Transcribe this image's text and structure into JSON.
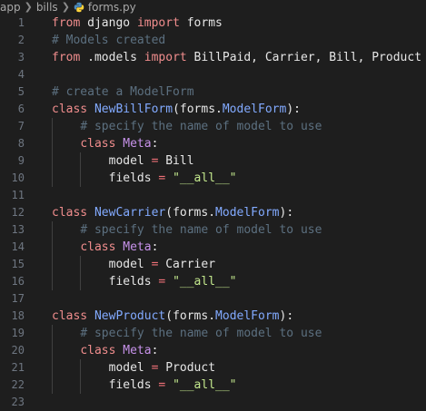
{
  "breadcrumb": {
    "items": [
      "app",
      "bills",
      "forms.py"
    ]
  },
  "icons": {
    "separator": "chevron-right-icon",
    "file": "python-file-icon"
  },
  "colors": {
    "background": "#1e1e1e",
    "keyword": "#f07178",
    "class_name": "#82aaff",
    "string": "#c3e88d",
    "comment": "#5c7080"
  },
  "editor": {
    "lines": [
      [
        [
          "kw",
          "from"
        ],
        [
          "plain",
          " django "
        ],
        [
          "kw",
          "import"
        ],
        [
          "plain",
          " forms"
        ]
      ],
      [
        [
          "cmt",
          "# Models created"
        ]
      ],
      [
        [
          "kw",
          "from"
        ],
        [
          "plain",
          " .models "
        ],
        [
          "kw",
          "import"
        ],
        [
          "plain",
          " BillPaid, Carrier, Bill, Product"
        ]
      ],
      [],
      [
        [
          "cmt",
          "# create a ModelForm"
        ]
      ],
      [
        [
          "kw",
          "class"
        ],
        [
          "plain",
          " "
        ],
        [
          "fn",
          "NewBillForm"
        ],
        [
          "plain",
          "(forms."
        ],
        [
          "fn",
          "ModelForm"
        ],
        [
          "plain",
          "):"
        ]
      ],
      [
        [
          "plain",
          "    "
        ],
        [
          "cmt",
          "# specify the name of model to use"
        ]
      ],
      [
        [
          "plain",
          "    "
        ],
        [
          "kw",
          "class"
        ],
        [
          "plain",
          " "
        ],
        [
          "cls",
          "Meta"
        ],
        [
          "plain",
          ":"
        ]
      ],
      [
        [
          "plain",
          "        model "
        ],
        [
          "op",
          "="
        ],
        [
          "plain",
          " Bill"
        ]
      ],
      [
        [
          "plain",
          "        fields "
        ],
        [
          "op",
          "="
        ],
        [
          "plain",
          " "
        ],
        [
          "str",
          "\"__all__\""
        ]
      ],
      [],
      [
        [
          "kw",
          "class"
        ],
        [
          "plain",
          " "
        ],
        [
          "fn",
          "NewCarrier"
        ],
        [
          "plain",
          "(forms."
        ],
        [
          "fn",
          "ModelForm"
        ],
        [
          "plain",
          "):"
        ]
      ],
      [
        [
          "plain",
          "    "
        ],
        [
          "cmt",
          "# specify the name of model to use"
        ]
      ],
      [
        [
          "plain",
          "    "
        ],
        [
          "kw",
          "class"
        ],
        [
          "plain",
          " "
        ],
        [
          "cls",
          "Meta"
        ],
        [
          "plain",
          ":"
        ]
      ],
      [
        [
          "plain",
          "        model "
        ],
        [
          "op",
          "="
        ],
        [
          "plain",
          " Carrier"
        ]
      ],
      [
        [
          "plain",
          "        fields "
        ],
        [
          "op",
          "="
        ],
        [
          "plain",
          " "
        ],
        [
          "str",
          "\"__all__\""
        ]
      ],
      [],
      [
        [
          "kw",
          "class"
        ],
        [
          "plain",
          " "
        ],
        [
          "fn",
          "NewProduct"
        ],
        [
          "plain",
          "(forms."
        ],
        [
          "fn",
          "ModelForm"
        ],
        [
          "plain",
          "):"
        ]
      ],
      [
        [
          "plain",
          "    "
        ],
        [
          "cmt",
          "# specify the name of model to use"
        ]
      ],
      [
        [
          "plain",
          "    "
        ],
        [
          "kw",
          "class"
        ],
        [
          "plain",
          " "
        ],
        [
          "cls",
          "Meta"
        ],
        [
          "plain",
          ":"
        ]
      ],
      [
        [
          "plain",
          "        model "
        ],
        [
          "op",
          "="
        ],
        [
          "plain",
          " Product"
        ]
      ],
      [
        [
          "plain",
          "        fields "
        ],
        [
          "op",
          "="
        ],
        [
          "plain",
          " "
        ],
        [
          "str",
          "\"__all__\""
        ]
      ],
      []
    ],
    "line_numbers": [
      "1",
      "2",
      "3",
      "4",
      "5",
      "6",
      "7",
      "8",
      "9",
      "10",
      "11",
      "12",
      "13",
      "14",
      "15",
      "16",
      "17",
      "18",
      "19",
      "20",
      "21",
      "22",
      "23"
    ]
  }
}
